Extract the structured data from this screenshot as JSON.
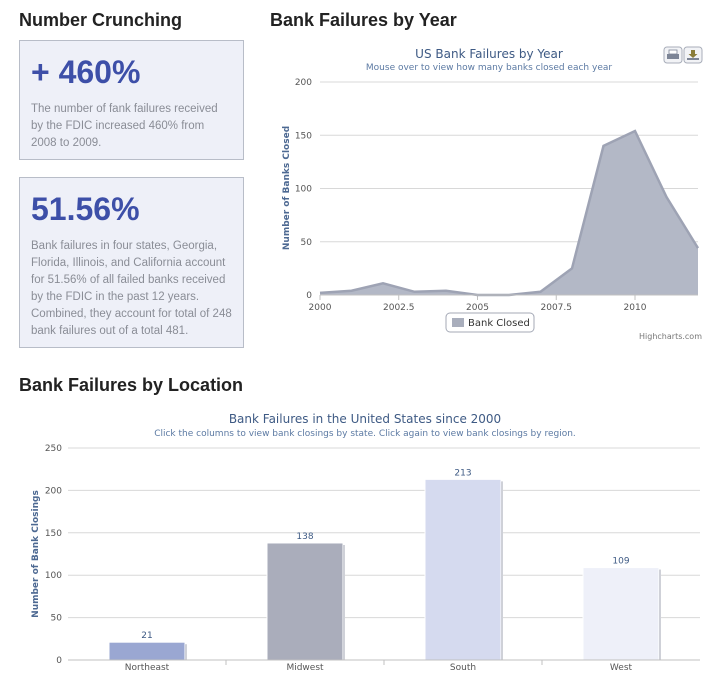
{
  "number_crunching": {
    "heading": "Number Crunching",
    "stats": [
      {
        "value": "+ 460%",
        "text": "The number of fank failures received by the FDIC increased 460% from 2008 to 2009."
      },
      {
        "value": "51.56%",
        "text": "Bank failures in four states, Georgia, Florida, Illinois, and California account for 51.56% of all failed banks received by the FDIC in the past 12 years. Combined, they account for total of 248 bank failures out of a total 481."
      }
    ]
  },
  "by_year": {
    "heading": "Bank Failures by Year",
    "buttons": {
      "print_icon": "printer-icon",
      "export_icon": "download-icon"
    },
    "credits": "Highcharts.com",
    "legend_label": "Bank Closed",
    "colors": {
      "fill": "#b3b8c6",
      "line": "#9ea3b4",
      "legend_swatch": "#a9aebc"
    }
  },
  "by_location": {
    "heading": "Bank Failures by Location",
    "colors": [
      "#9aa7d2",
      "#aaadbb",
      "#d5daef",
      "#eef0f9"
    ]
  },
  "chart_data": [
    {
      "type": "area",
      "title": "US Bank Failures by Year",
      "subtitle": "Mouse over to view how many banks closed each year",
      "xlabel": "",
      "ylabel": "Number of Banks Closed",
      "series": [
        {
          "name": "Bank Closed",
          "x": [
            2000,
            2001,
            2002,
            2003,
            2004,
            2005,
            2006,
            2007,
            2008,
            2009,
            2010,
            2011,
            2012
          ],
          "values": [
            2,
            4,
            11,
            3,
            4,
            0,
            0,
            3,
            25,
            140,
            154,
            92,
            44
          ]
        }
      ],
      "xlim": [
        2000,
        2012
      ],
      "ylim": [
        0,
        200
      ],
      "xticks": [
        "2000",
        "2002.5",
        "2005",
        "2007.5",
        "2010"
      ],
      "yticks": [
        "0",
        "50",
        "100",
        "150",
        "200"
      ],
      "legend": "bottom-center"
    },
    {
      "type": "bar",
      "title": "Bank Failures in the United States since 2000",
      "subtitle": "Click the columns to view bank closings by state. Click again to view bank closings by region.",
      "xlabel": "",
      "ylabel": "Number of Bank Closings",
      "categories": [
        "Northeast",
        "Midwest",
        "South",
        "West"
      ],
      "values": [
        21,
        138,
        213,
        109
      ],
      "ylim": [
        0,
        250
      ],
      "yticks": [
        "0",
        "50",
        "100",
        "150",
        "200",
        "250"
      ]
    }
  ]
}
